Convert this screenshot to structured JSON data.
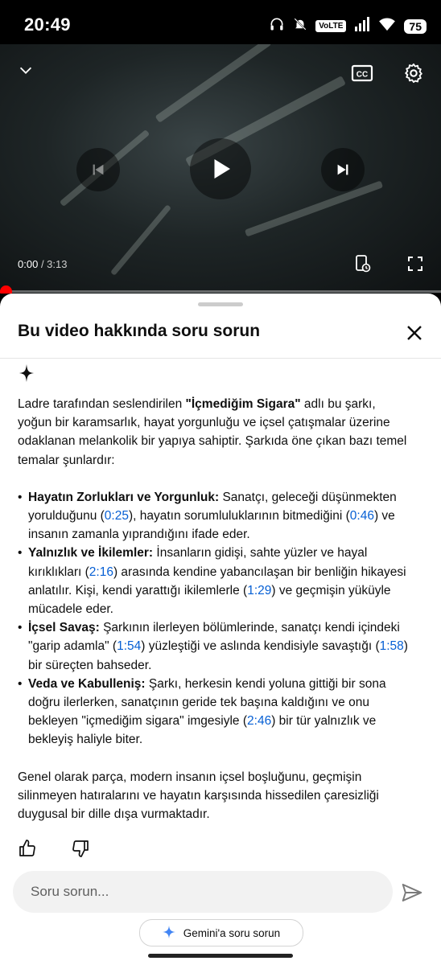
{
  "status_bar": {
    "time": "20:49",
    "network_badge": "VoLTE",
    "battery": "75",
    "icons": [
      "headphones-icon",
      "bell-off-icon",
      "signal-icon",
      "wifi-icon",
      "battery-icon"
    ]
  },
  "player": {
    "current_time": "0:00",
    "duration": "/ 3:13",
    "progress": 0,
    "icons": [
      "chevron-down-icon",
      "captions-icon",
      "settings-icon",
      "previous-icon",
      "play-icon",
      "next-icon",
      "add-to-queue-icon",
      "fullscreen-icon"
    ]
  },
  "sheet": {
    "title": "Bu video hakkında soru sorun",
    "intro": {
      "pre": "Ladre tarafından seslendirilen ",
      "bold": "\"İçmediğim Sigara\"",
      "post": " adlı bu şarkı, yoğun bir karamsarlık, hayat yorgunluğu ve içsel çatışmalar üzerine odaklanan melankolik bir yapıya sahiptir. Şarkıda öne çıkan bazı temel temalar şunlardır:"
    },
    "bullets": [
      {
        "heading": "Hayatın Zorlukları ve Yorgunluk:",
        "t1": " Sanatçı, geleceği düşünmekten yorulduğunu (",
        "ts1": "0:25",
        "t2": "), hayatın sorumluluklarının bitmediğini (",
        "ts2": "0:46",
        "t3": ") ve insanın zamanla yıprandığını ifade eder."
      },
      {
        "heading": "Yalnızlık ve İkilemler:",
        "t1": " İnsanların gidişi, sahte yüzler ve hayal kırıklıkları (",
        "ts1": "2:16",
        "t2": ") arasında kendine yabancılaşan bir benliğin hikayesi anlatılır. Kişi, kendi yarattığı ikilemlerle (",
        "ts2": "1:29",
        "t3": ") ve geçmişin yüküyle mücadele eder."
      },
      {
        "heading": "İçsel Savaş:",
        "t1": " Şarkının ilerleyen bölümlerinde, sanatçı kendi içindeki \"garip adamla\" (",
        "ts1": "1:54",
        "t2": ") yüzleştiği ve aslında kendisiyle savaştığı (",
        "ts2": "1:58",
        "t3": ") bir süreçten bahseder."
      },
      {
        "heading": "Veda ve Kabulleniş:",
        "t1": " Şarkı, herkesin kendi yoluna gittiği bir sona doğru ilerlerken, sanatçının geride tek başına kaldığını ve onu bekleyen \"içmediğim sigara\" imgesiyle (",
        "ts1": "2:46",
        "t2": ") bir tür yalnızlık ve bekleyiş haliyle biter.",
        "ts2": "",
        "t3": ""
      }
    ],
    "conclusion": "Genel olarak parça, modern insanın içsel boşluğunu, geçmişin silinmeyen hatıralarını ve hayatın karşısında hissedilen çaresizliği duygusal bir dille dışa vurmaktadır.",
    "input_placeholder": "Soru sorun...",
    "gemini_button": "Gemini'a soru sorun"
  },
  "colors": {
    "accent_link": "#065fd4",
    "progress_red": "#ff0000",
    "sheet_bg": "#ffffff"
  }
}
